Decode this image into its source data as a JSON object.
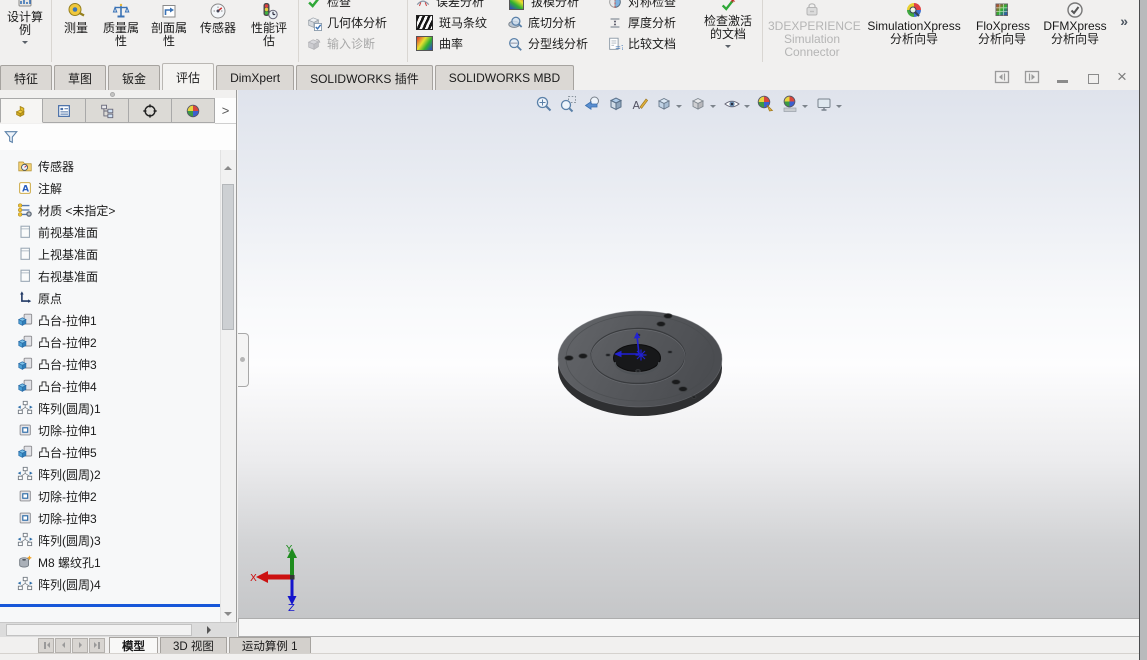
{
  "ribbon": {
    "design_study": "设计算例",
    "measure": "测量",
    "mass_properties": "质量属性",
    "section_properties": "剖面属性",
    "sensor": "传感器",
    "performance_evaluation": "性能评估",
    "check": "检查",
    "geometry_analysis": "几何体分析",
    "import_diagnostics": "输入诊断",
    "deviation_analysis": "误差分析",
    "zebra_stripes": "斑马条纹",
    "curvature": "曲率",
    "draft_analysis": "拔模分析",
    "undercut_analysis": "底切分析",
    "parting_line_analysis": "分型线分析",
    "symmetry_check": "对称检查",
    "thickness_analysis": "厚度分析",
    "compare_documents": "比较文档",
    "check_active_documents": "检查激活的文档",
    "experience_connector": "3DEXPERIENCE Simulation Connector",
    "simulationxpress": "SimulationXpress 分析向导",
    "floxpress": "FloXpress 分析向导",
    "dfmxpress": "DFMXpress 分析向导"
  },
  "command_tabs": {
    "items": [
      "特征",
      "草图",
      "钣金",
      "评估",
      "DimXpert",
      "SOLIDWORKS 插件",
      "SOLIDWORKS MBD"
    ],
    "active": "评估"
  },
  "feature_tree": {
    "items": [
      {
        "label": "传感器"
      },
      {
        "label": "注解"
      },
      {
        "label": "材质 <未指定>"
      },
      {
        "label": "前视基准面"
      },
      {
        "label": "上视基准面"
      },
      {
        "label": "右视基准面"
      },
      {
        "label": "原点"
      },
      {
        "label": "凸台-拉伸1"
      },
      {
        "label": "凸台-拉伸2"
      },
      {
        "label": "凸台-拉伸3"
      },
      {
        "label": "凸台-拉伸4"
      },
      {
        "label": "阵列(圆周)1"
      },
      {
        "label": "切除-拉伸1"
      },
      {
        "label": "凸台-拉伸5"
      },
      {
        "label": "阵列(圆周)2"
      },
      {
        "label": "切除-拉伸2"
      },
      {
        "label": "切除-拉伸3"
      },
      {
        "label": "阵列(圆周)3"
      },
      {
        "label": "M8 螺纹孔1"
      },
      {
        "label": "阵列(圆周)4"
      }
    ]
  },
  "sheet_tabs": {
    "items": [
      "模型",
      "3D 视图",
      "运动算例 1"
    ],
    "active": "模型"
  },
  "triad": {
    "x": "X",
    "y": "Y",
    "z": "Z"
  },
  "icons": {
    "overflow_chevron": "»",
    "panel_expand": ">",
    "close": "×"
  },
  "colors": {
    "viewport_top": "#dfe3ec",
    "viewport_mid": "#fdfdfe",
    "viewport_bottom": "#c5c6c8",
    "part_top_face": "#57595d",
    "part_side": "#2e2f31",
    "origin_marker_blue": "#2121d4",
    "rollback_bar_blue": "#1757d9",
    "triad_x_red": "#cc1111",
    "triad_y_green": "#1e8c1e",
    "triad_z_blue": "#1414cc"
  }
}
